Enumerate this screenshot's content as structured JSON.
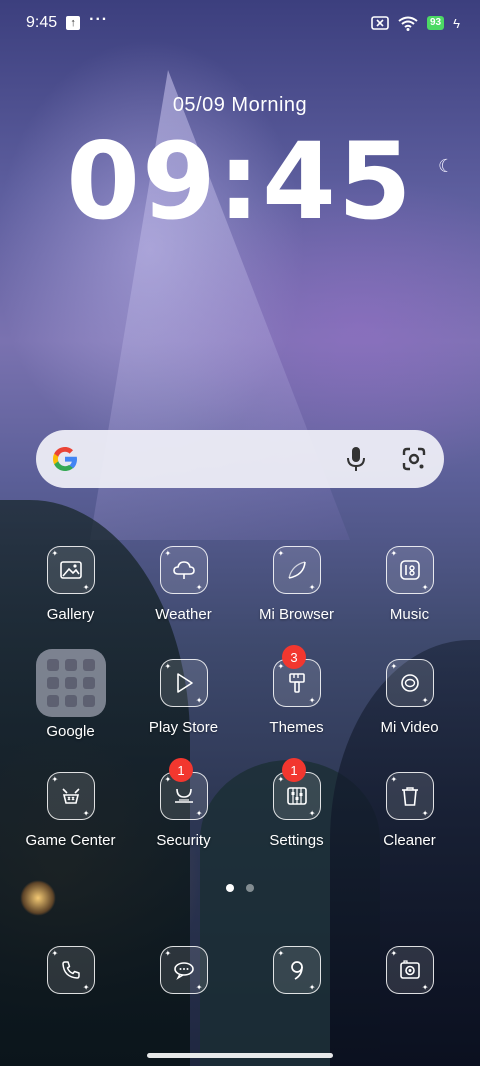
{
  "status_bar": {
    "time": "9:45",
    "more": "···",
    "battery": "93"
  },
  "lock": {
    "date_line": "05/09  Morning",
    "clock": "09:45"
  },
  "colors": {
    "badge": "#f2372f",
    "battery": "#4cd964",
    "search_bg": "#eeeef6"
  },
  "apps": [
    {
      "label": "Gallery",
      "icon": "image-icon"
    },
    {
      "label": "Weather",
      "icon": "cloud-icon"
    },
    {
      "label": "Mi Browser",
      "icon": "browser-icon"
    },
    {
      "label": "Music",
      "icon": "music-icon"
    },
    {
      "label": "Google",
      "icon": "folder-icon"
    },
    {
      "label": "Play Store",
      "icon": "play-icon"
    },
    {
      "label": "Themes",
      "icon": "brush-icon",
      "badge": "3"
    },
    {
      "label": "Mi Video",
      "icon": "video-icon"
    },
    {
      "label": "Game Center",
      "icon": "game-icon"
    },
    {
      "label": "Security",
      "icon": "security-icon",
      "badge": "1"
    },
    {
      "label": "Settings",
      "icon": "settings-icon",
      "badge": "1"
    },
    {
      "label": "Cleaner",
      "icon": "trash-icon"
    }
  ],
  "dock": [
    {
      "icon": "phone-icon"
    },
    {
      "icon": "message-icon"
    },
    {
      "icon": "camera-app-icon"
    },
    {
      "icon": "photo-camera-icon"
    }
  ],
  "page_indicator": {
    "count": 2,
    "active": 0
  }
}
